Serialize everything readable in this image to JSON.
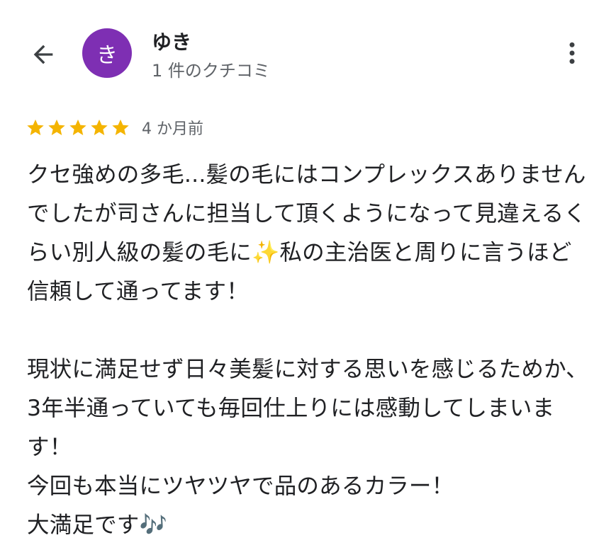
{
  "header": {
    "avatar_letter": "き",
    "avatar_color": "#7e2fb3",
    "reviewer_name": "ゆき",
    "review_count": "1 件のクチコミ"
  },
  "icons": {
    "back": "arrow-back-icon",
    "more": "more-vert-icon",
    "star": "star-icon"
  },
  "review": {
    "rating": 5,
    "star_color": "#f4b400",
    "time_ago": "4 か月前",
    "body": "クセ強めの多毛...髪の毛にはコンプレックスありませんでしたが司さんに担当して頂くようになって見違えるくらい別人級の髪の毛に✨私の主治医と周りに言うほど信頼して通ってます！\n\n現状に満足せず日々美髪に対する思いを感じるためか、3年半通っていても毎回仕上りには感動してしまいます！\n今回も本当にツヤツヤで品のあるカラー！\n大満足です🎶"
  }
}
